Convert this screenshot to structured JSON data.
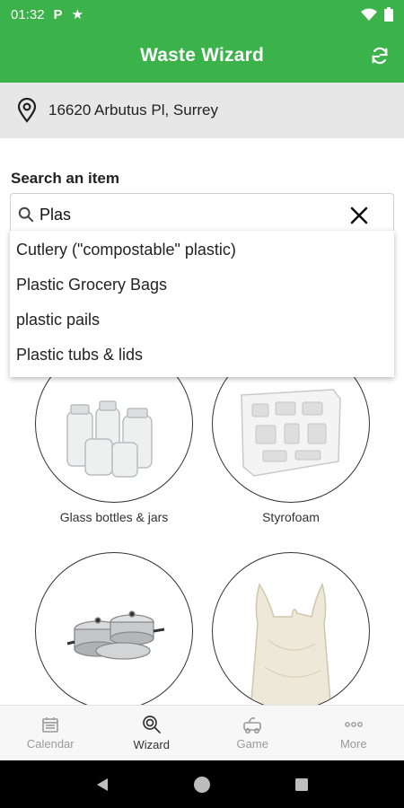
{
  "status_bar": {
    "time": "01:32",
    "notification_p": "P",
    "notification_star": "★"
  },
  "app_bar": {
    "title": "Waste Wizard"
  },
  "location": {
    "address": "16620 Arbutus Pl, Surrey"
  },
  "search": {
    "label": "Search an item",
    "value": "Plas"
  },
  "suggestions": [
    "Cutlery (\"compostable\" plastic)",
    "Plastic Grocery Bags",
    "plastic pails",
    "Plastic tubs & lids"
  ],
  "items": [
    {
      "label": "Glass bottles & jars",
      "icon": "glass-jars"
    },
    {
      "label": "Styrofoam",
      "icon": "styrofoam"
    },
    {
      "label": "",
      "icon": "pots-and-pans"
    },
    {
      "label": "",
      "icon": "plastic-bag"
    }
  ],
  "bottom_nav": [
    {
      "label": "Calendar",
      "icon": "calendar-icon",
      "active": false
    },
    {
      "label": "Wizard",
      "icon": "wizard-icon",
      "active": true
    },
    {
      "label": "Game",
      "icon": "game-icon",
      "active": false
    },
    {
      "label": "More",
      "icon": "more-icon",
      "active": false
    }
  ],
  "colors": {
    "primary": "#3cb24a",
    "address_bg": "#e7e7e7",
    "nav_inactive": "#9a9a9a",
    "nav_active": "#333333"
  }
}
